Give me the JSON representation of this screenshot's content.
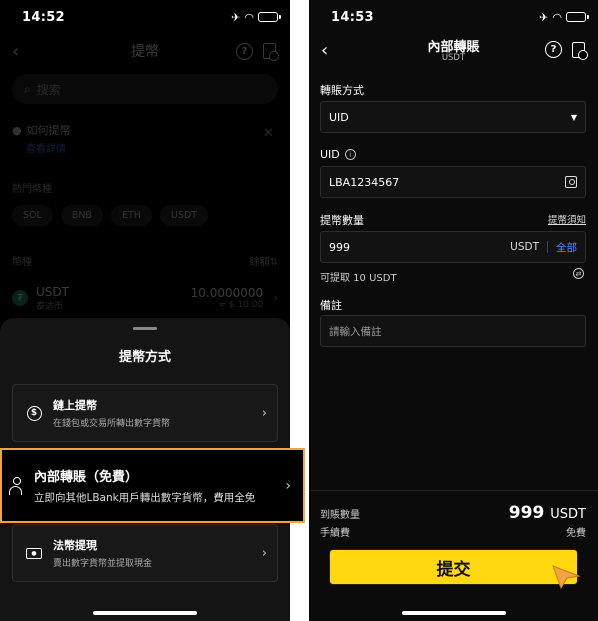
{
  "left_screen": {
    "time": "14:52",
    "nav_title": "提幣",
    "search_placeholder": "搜索",
    "howto_title": "如何提幣",
    "howto_link": "查看詳情",
    "hot_label": "熱門幣種",
    "hot_coins": [
      "SOL",
      "BNB",
      "ETH",
      "USDT"
    ],
    "coin_header": "幣種",
    "coin_sort": "餘額⇅",
    "coin": {
      "symbol": "USDT",
      "name": "泰达币",
      "amount": "10.0000000",
      "fiat": "≈ $ 10.00"
    },
    "sheet": {
      "title": "提幣方式",
      "options": [
        {
          "title": "鏈上提幣",
          "desc": "在錢包或交易所轉出數字貨幣",
          "icon": "coin-transfer-icon"
        },
        {
          "title": "內部轉賬（免費）",
          "desc": "立即向其他LBank用戶轉出數字貨幣，費用全免",
          "icon": "user-transfer-icon"
        },
        {
          "title": "法幣提現",
          "desc": "賣出數字貨幣並提取現金",
          "icon": "cash-icon"
        }
      ]
    },
    "highlight_color": "#f0a340"
  },
  "right_screen": {
    "time": "14:53",
    "nav_title": "內部轉賬",
    "nav_subtitle": "USDT",
    "method_label": "轉賬方式",
    "method_value": "UID",
    "uid_label": "UID",
    "uid_value": "LBA1234567",
    "amount_label": "提幣數量",
    "notice_link": "提幣須知",
    "amount_value": "999",
    "amount_unit": "USDT",
    "all_button": "全部",
    "available": "可提取 10 USDT",
    "remark_label": "備註",
    "remark_placeholder": "請輸入備註",
    "receive_label": "到賬數量",
    "receive_amount": "999",
    "receive_unit": "USDT",
    "fee_label": "手續費",
    "fee_value": "免費",
    "submit_label": "提交",
    "accent_color": "#ffd80f",
    "link_color": "#4d8bff"
  }
}
